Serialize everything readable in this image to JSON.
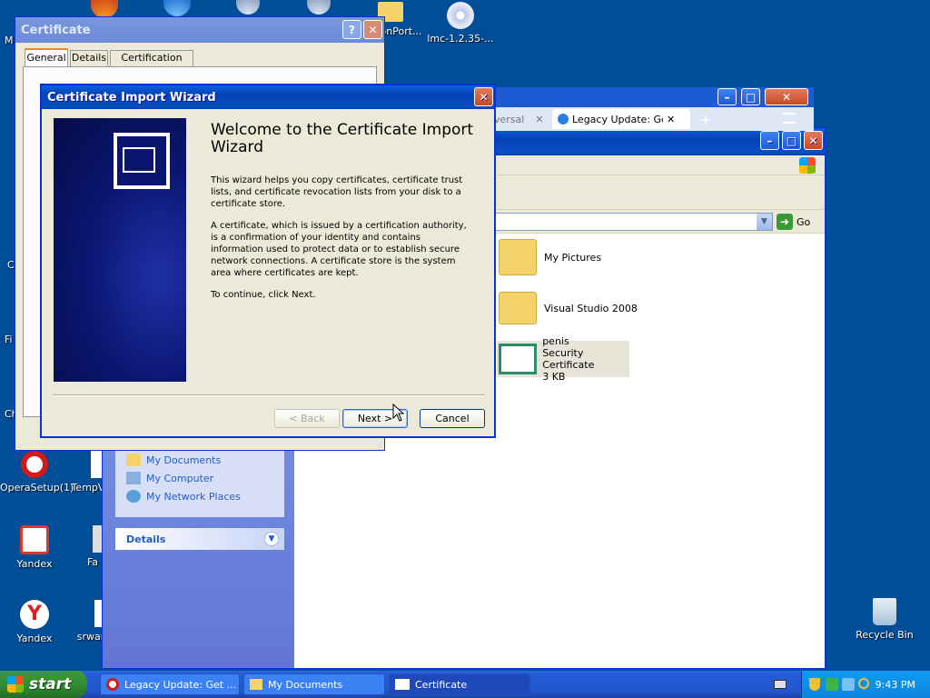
{
  "desktop_icons": [
    {
      "label": "OperaSetup(1)",
      "icon": "opera-icon"
    },
    {
      "label": "TempV",
      "icon": "file-icon"
    },
    {
      "label": "Yandex",
      "icon": "yandex-box-icon"
    },
    {
      "label": "Fa",
      "icon": "shortcut-icon"
    },
    {
      "label": "Yandex",
      "icon": "yandex-icon"
    },
    {
      "label": "srwar",
      "icon": "file-icon"
    },
    {
      "label": "ionPort...",
      "icon": "folder-icon"
    },
    {
      "label": "lmc-1.2.35-...",
      "icon": "cd-icon"
    },
    {
      "label": "Recycle Bin",
      "icon": "recycle-bin-icon"
    },
    {
      "label": "M",
      "icon": "computer-icon"
    },
    {
      "label": "C",
      "icon": "file-icon"
    },
    {
      "label": "Fi",
      "icon": "file-icon"
    },
    {
      "label": "Ch",
      "icon": "file-icon"
    }
  ],
  "cert_window": {
    "title": "Certificate",
    "tabs": [
      "General",
      "Details",
      "Certification Path"
    ]
  },
  "browser_window": {
    "tab1": "versal",
    "tab2": "Legacy Update: Get L"
  },
  "explorer": {
    "go_label": "Go",
    "sidebar_links": [
      "My Documents",
      "My Computer",
      "My Network Places"
    ],
    "details_label": "Details",
    "items": [
      {
        "name": "My Pictures",
        "icon": "pictures-folder-icon"
      },
      {
        "name": "Visual Studio 2008",
        "icon": "folder-icon"
      },
      {
        "name": "penis",
        "type": "Security Certificate",
        "size": "3 KB",
        "icon": "certificate-file-icon"
      }
    ]
  },
  "wizard": {
    "title": "Certificate Import Wizard",
    "heading": "Welcome to the Certificate Import Wizard",
    "para1": "This wizard helps you copy certificates, certificate trust lists, and certificate revocation lists from your disk to a certificate store.",
    "para2": "A certificate, which is issued by a certification authority, is a confirmation of your identity and contains information used to protect data or to establish secure network connections. A certificate store is the system area where certificates are kept.",
    "para3": "To continue, click Next.",
    "back_label": "< Back",
    "next_label": "Next >",
    "cancel_label": "Cancel"
  },
  "taskbar": {
    "start_label": "start",
    "tasks": [
      "Legacy Update: Get ...",
      "My Documents",
      "Certificate"
    ],
    "clock": "9:43 PM"
  }
}
